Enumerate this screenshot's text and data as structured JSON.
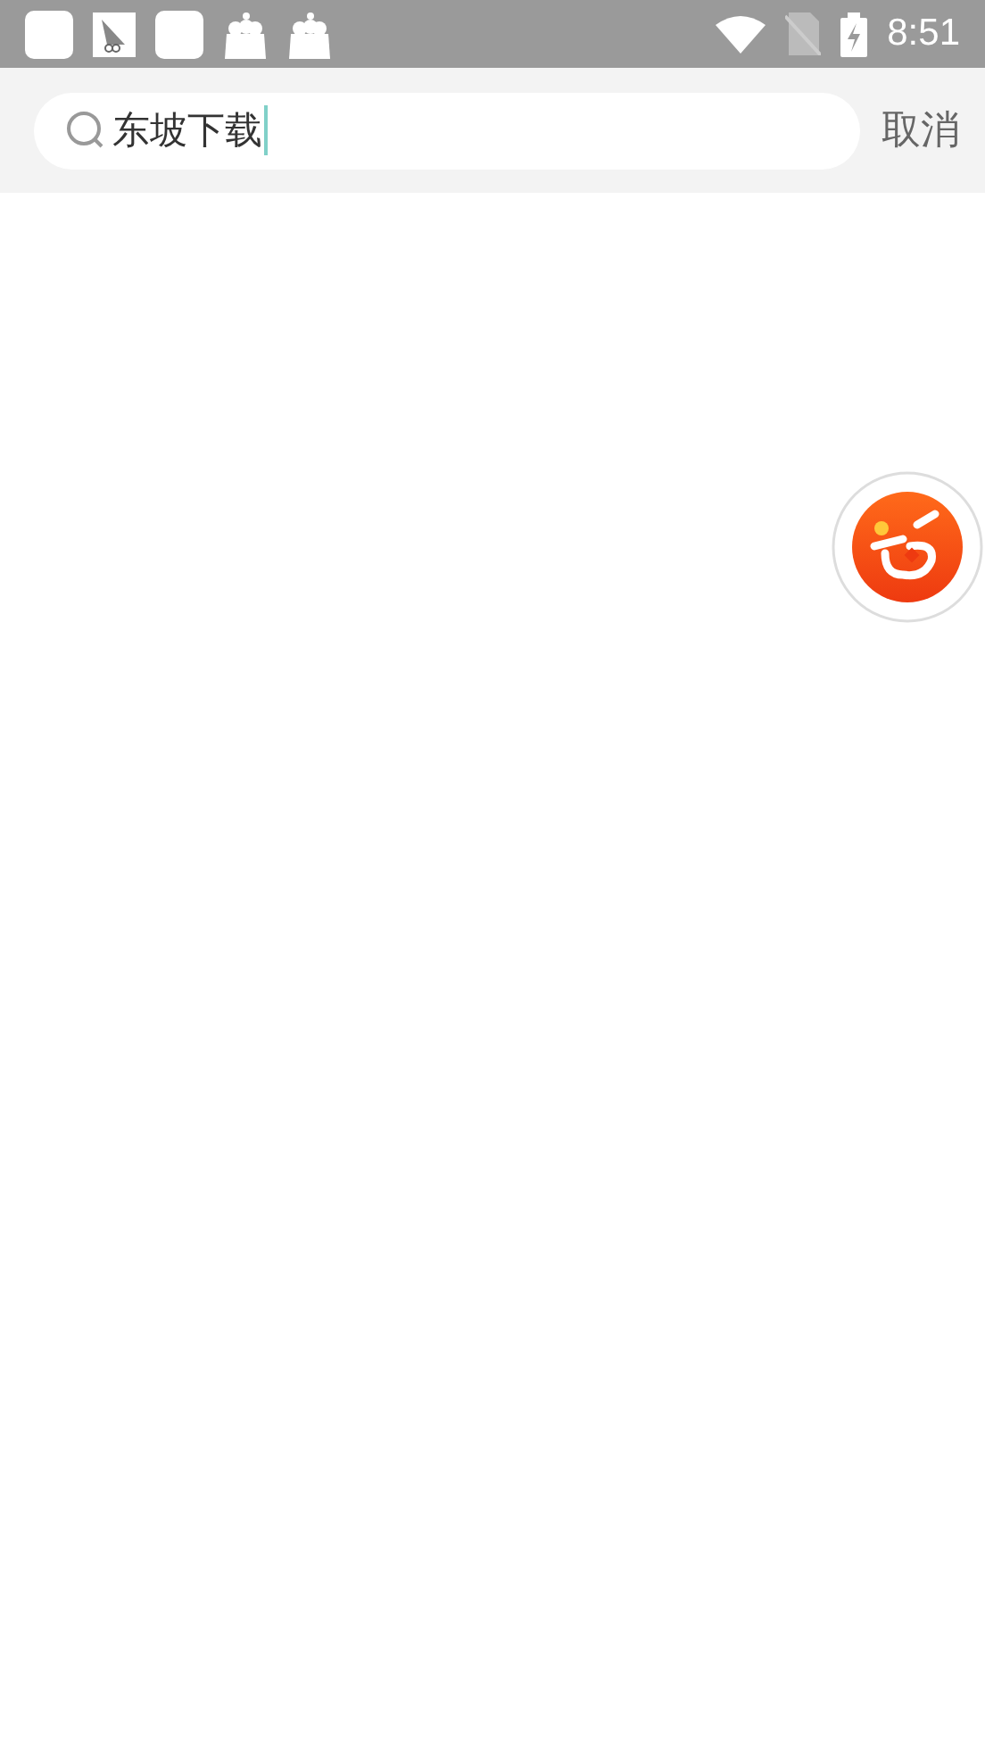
{
  "status_bar": {
    "time": "8:51"
  },
  "search": {
    "value": "东坡下载",
    "cancel": "取消"
  }
}
